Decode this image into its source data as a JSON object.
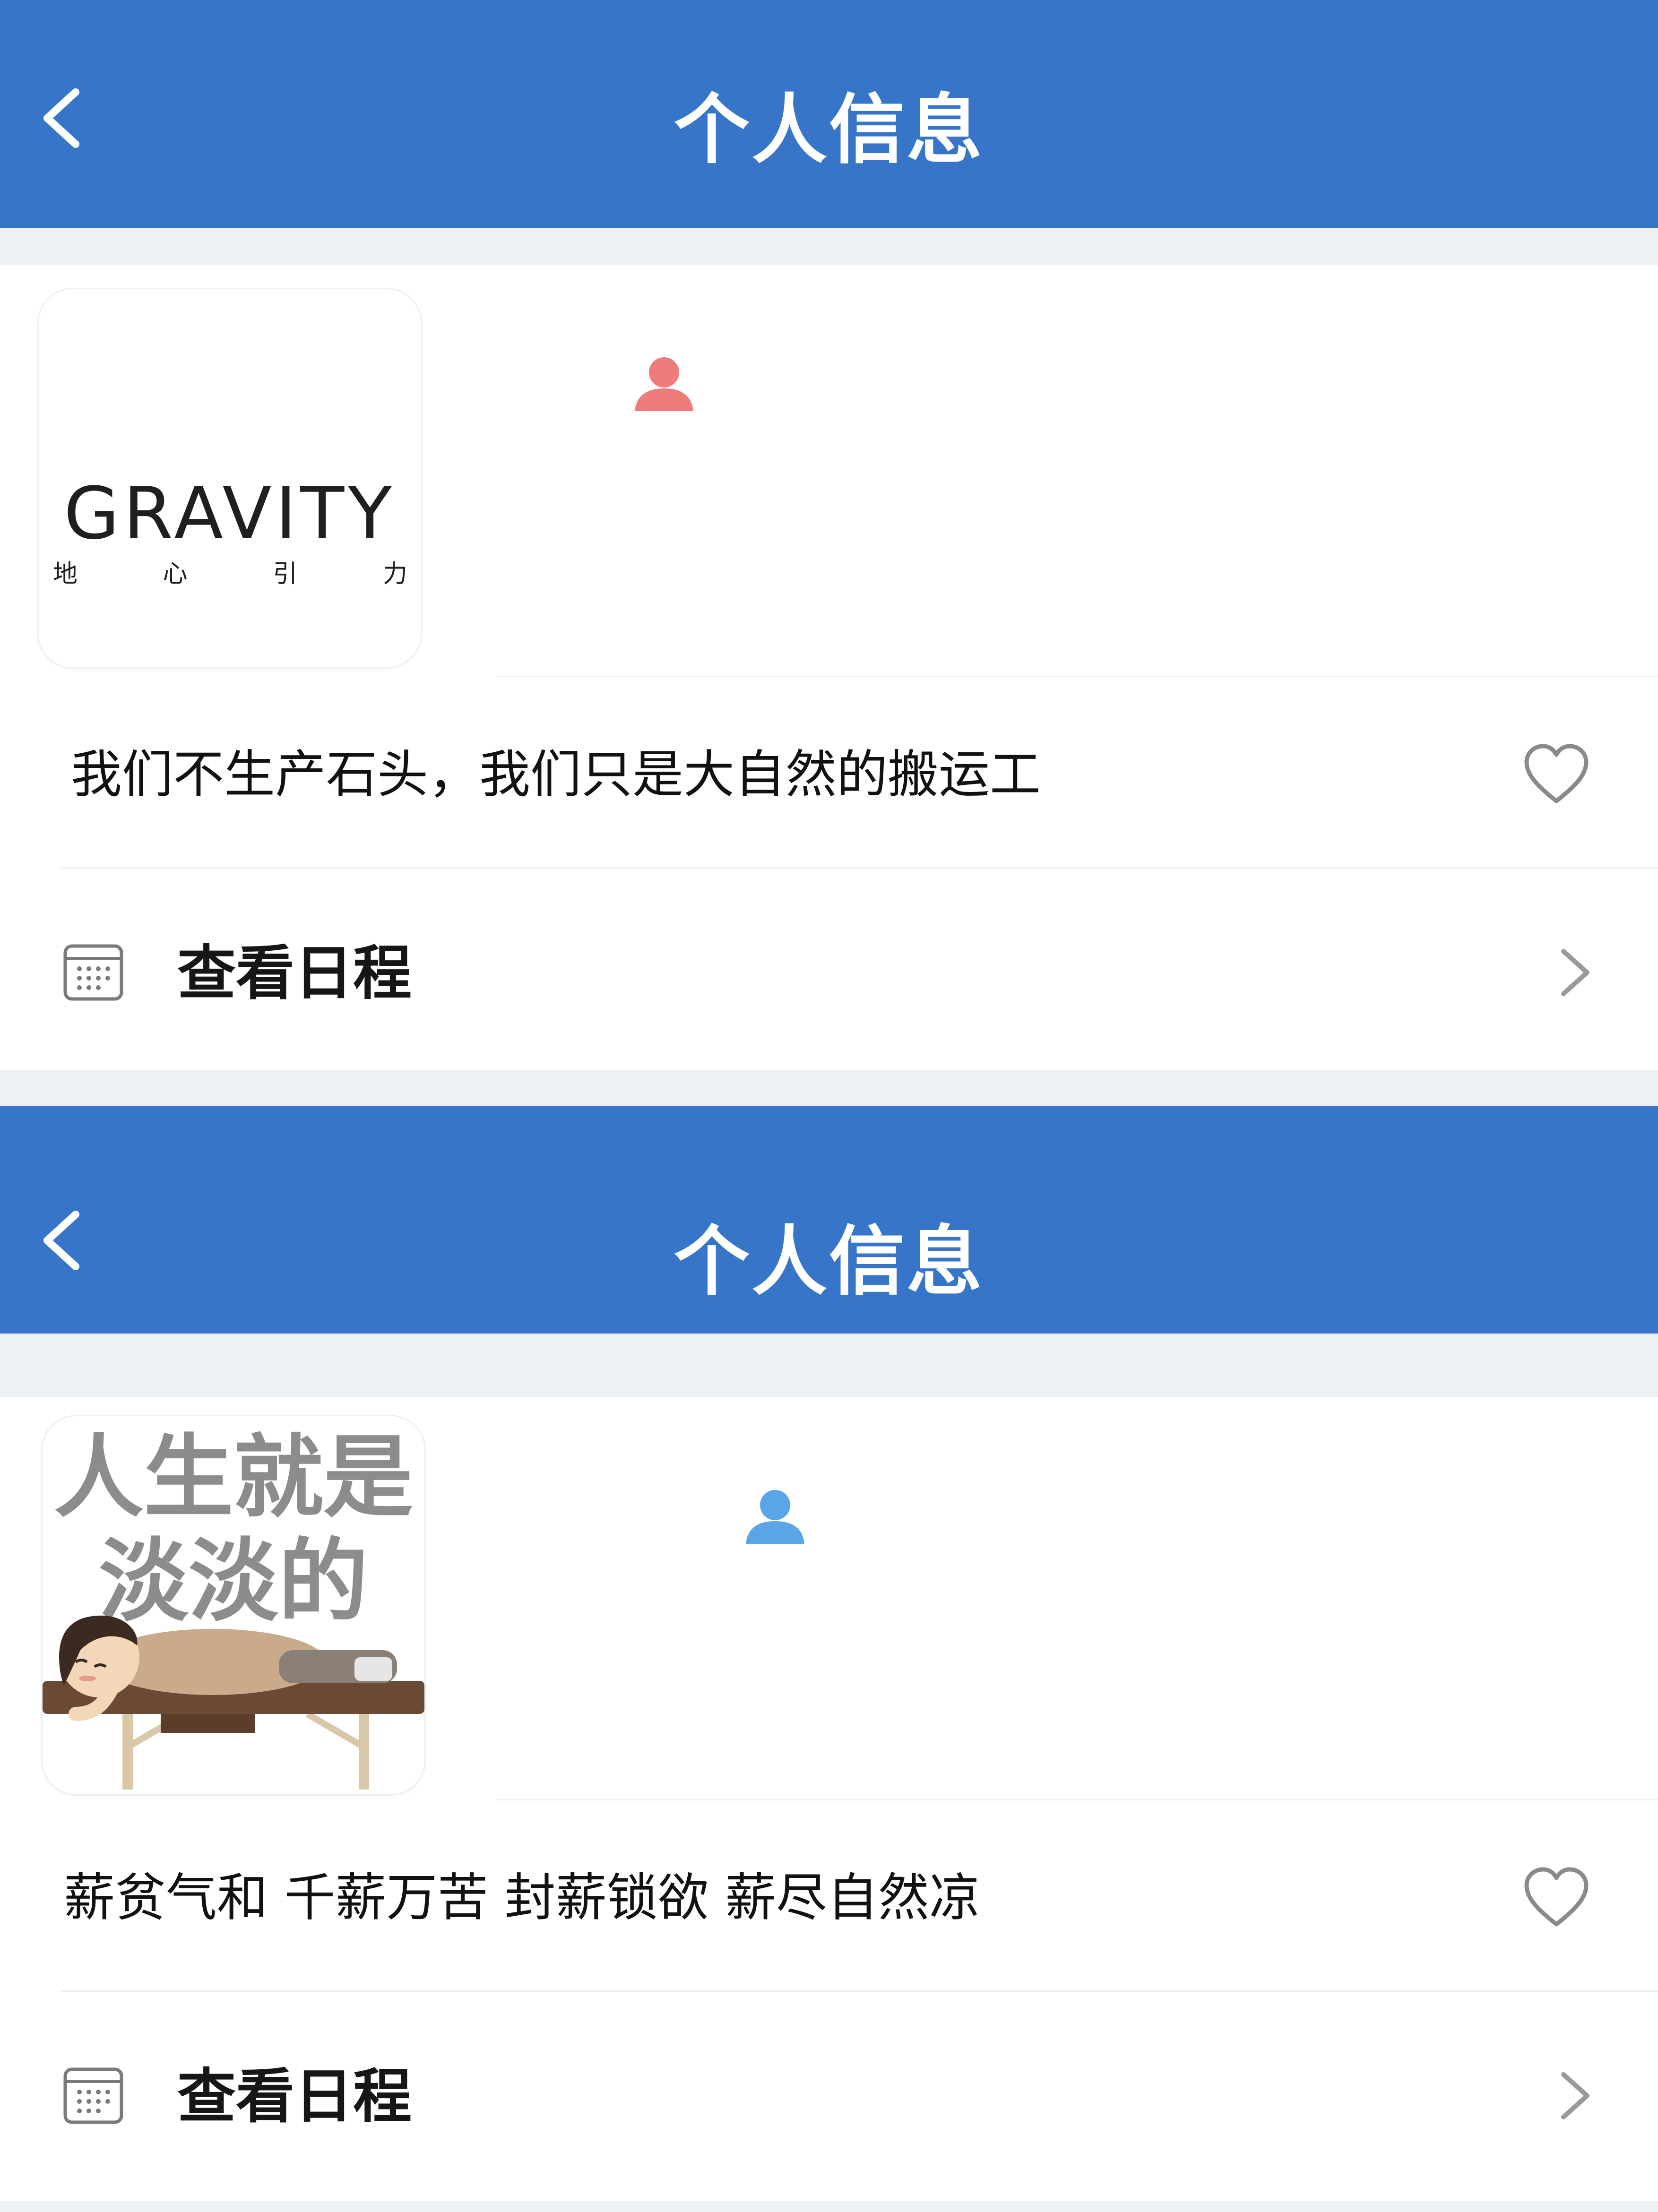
{
  "screens": [
    {
      "nav": {
        "title": "个人信息",
        "back_icon": "chevron-left-icon"
      },
      "avatar": {
        "logo_text": "GRAVITY",
        "logo_sub": [
          "地",
          "心",
          "引",
          "力"
        ]
      },
      "person_icon": {
        "name": "person-icon",
        "color": "#f07b7b"
      },
      "motto": "我们不生产石头，我们只是大自然的搬运工",
      "like_icon": "heart-outline-icon",
      "schedule": {
        "label": "查看日程",
        "icon": "calendar-icon",
        "chevron": "chevron-right-icon"
      }
    },
    {
      "nav": {
        "title": "个人信息",
        "back_icon": "chevron-left-icon"
      },
      "avatar": {
        "line1": "人生就是",
        "line2": "淡淡的"
      },
      "person_icon": {
        "name": "person-icon",
        "color": "#5aa5e6"
      },
      "motto": "薪贫气和 千薪万苦 封薪锁欲 薪尽自然凉",
      "like_icon": "heart-outline-icon",
      "schedule": {
        "label": "查看日程",
        "icon": "calendar-icon",
        "chevron": "chevron-right-icon"
      }
    }
  ],
  "colors": {
    "nav_bg": "#3775c8",
    "background": "#eef1f4",
    "card": "#ffffff"
  }
}
